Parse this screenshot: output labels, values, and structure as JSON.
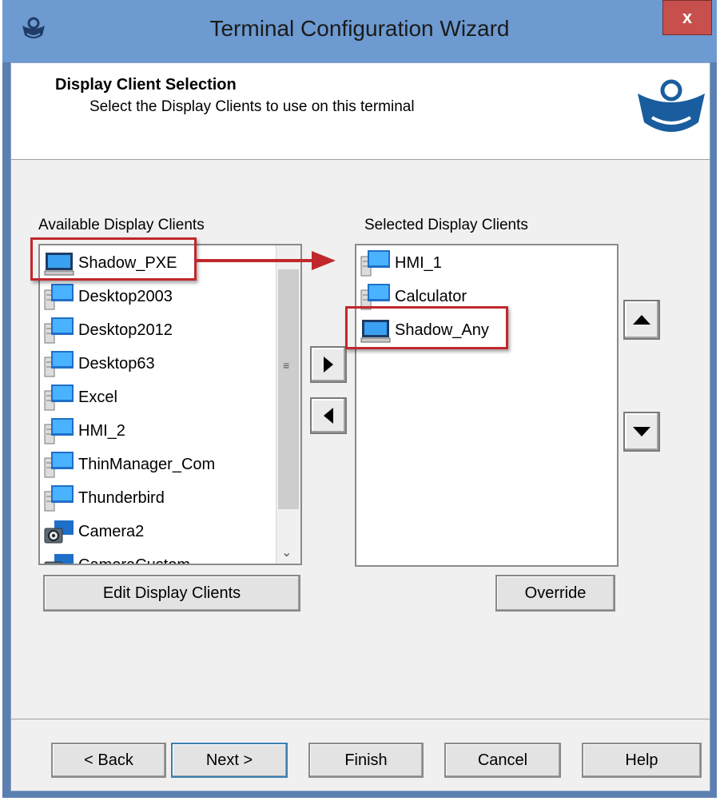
{
  "window": {
    "title": "Terminal Configuration Wizard",
    "close_label": "x"
  },
  "header": {
    "title": "Display Client Selection",
    "subtitle": "Select the Display Clients to use on this terminal"
  },
  "available": {
    "label": "Available Display Clients",
    "items": [
      {
        "label": "Shadow_PXE",
        "icon": "monitor-icon"
      },
      {
        "label": "Desktop2003",
        "icon": "server-icon"
      },
      {
        "label": "Desktop2012",
        "icon": "server-icon"
      },
      {
        "label": "Desktop63",
        "icon": "server-icon"
      },
      {
        "label": "Excel",
        "icon": "server-icon"
      },
      {
        "label": "HMI_2",
        "icon": "server-icon"
      },
      {
        "label": "ThinManager_Com",
        "icon": "server-icon"
      },
      {
        "label": "Thunderbird",
        "icon": "server-icon"
      },
      {
        "label": "Camera2",
        "icon": "camera-icon"
      },
      {
        "label": "CameraCustom",
        "icon": "camera-icon"
      }
    ],
    "edit_button": "Edit Display Clients"
  },
  "selected": {
    "label": "Selected Display Clients",
    "items": [
      {
        "label": "HMI_1",
        "icon": "server-icon"
      },
      {
        "label": "Calculator",
        "icon": "server-icon"
      },
      {
        "label": "Shadow_Any",
        "icon": "monitor-icon"
      }
    ],
    "override_button": "Override"
  },
  "footer": {
    "back": "< Back",
    "next": "Next >",
    "finish": "Finish",
    "cancel": "Cancel",
    "help": "Help"
  },
  "colors": {
    "titlebar": "#6d9ad0",
    "close": "#c7504c",
    "highlight": "#c0282d"
  }
}
